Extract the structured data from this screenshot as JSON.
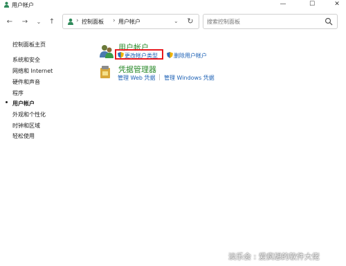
{
  "window": {
    "title": "用户帐户",
    "controls": {
      "minimize": "—",
      "maximize": "☐",
      "close": "✕"
    }
  },
  "address": {
    "crumbs": [
      "控制面板",
      "用户帐户"
    ],
    "separator": "›",
    "dropdown": "⌄",
    "refresh": "↻"
  },
  "search": {
    "placeholder": "搜索控制面板"
  },
  "nav": {
    "back": "←",
    "forward": "→",
    "recent": "⌄",
    "up": "↑"
  },
  "sidebar": {
    "items": [
      {
        "label": "控制面板主页"
      },
      {
        "label": "系统和安全"
      },
      {
        "label": "网络和 Internet"
      },
      {
        "label": "硬件和声音"
      },
      {
        "label": "程序"
      },
      {
        "label": "用户帐户",
        "active": true
      },
      {
        "label": "外观和个性化"
      },
      {
        "label": "时钟和区域"
      },
      {
        "label": "轻松使用"
      }
    ]
  },
  "main": {
    "user_accounts": {
      "title": "用户帐户",
      "links": [
        "更改帐户类型",
        "删除用户帐户"
      ]
    },
    "credential_manager": {
      "title": "凭据管理器",
      "links": [
        "管理 Web 凭据",
        "管理 Windows 凭据"
      ]
    }
  },
  "colors": {
    "accent_green": "#2b8a2b",
    "link_blue": "#1a5fb4",
    "highlight_red": "#e8181e"
  },
  "watermark": "淡乐会 : 爱疯想的软件大佬"
}
